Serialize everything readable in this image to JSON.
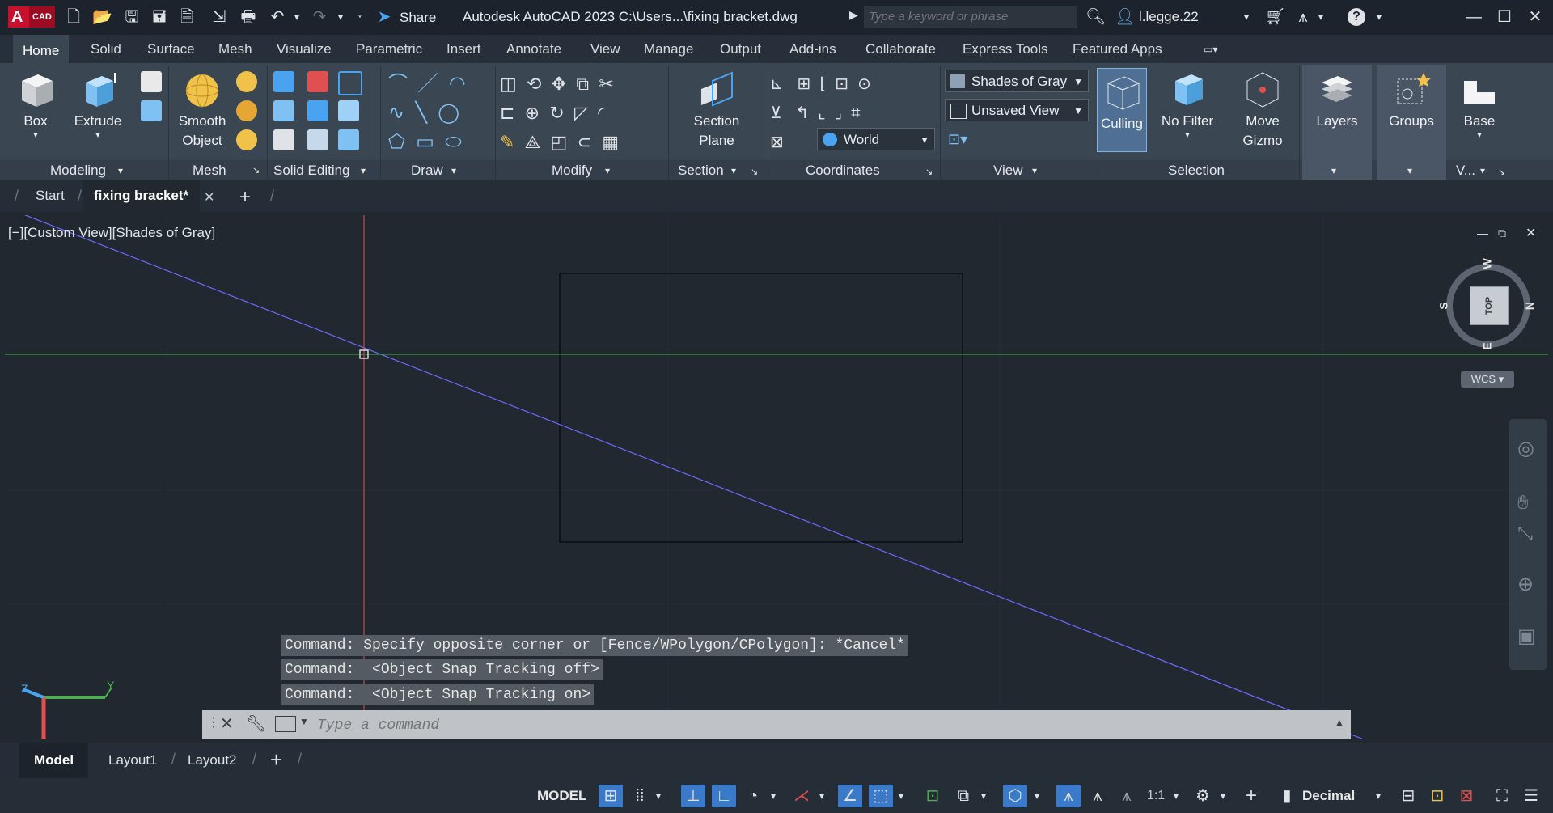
{
  "titlebar": {
    "app_logo_letter": "A",
    "app_logo_badge": "CAD",
    "share_label": "Share",
    "title": "Autodesk AutoCAD 2023    C:\\Users...\\fixing bracket.dwg",
    "search_placeholder": "Type a keyword or phrase",
    "user_name": "l.legge.22"
  },
  "ribbon_tabs": [
    "Home",
    "Solid",
    "Surface",
    "Mesh",
    "Visualize",
    "Parametric",
    "Insert",
    "Annotate",
    "View",
    "Manage",
    "Output",
    "Add-ins",
    "Collaborate",
    "Express Tools",
    "Featured Apps"
  ],
  "ribbon": {
    "modeling": {
      "box": "Box",
      "extrude": "Extrude",
      "label": "Modeling"
    },
    "mesh": {
      "smooth": "Smooth",
      "object": "Object",
      "label": "Mesh"
    },
    "solid_editing": {
      "label": "Solid Editing"
    },
    "draw": {
      "label": "Draw"
    },
    "modify": {
      "label": "Modify"
    },
    "section": {
      "section": "Section",
      "plane": "Plane",
      "label": "Section"
    },
    "coordinates": {
      "world": "World",
      "label": "Coordinates"
    },
    "view": {
      "visual_style": "Shades of Gray",
      "saved_view": "Unsaved View",
      "label": "View"
    },
    "selection": {
      "culling": "Culling",
      "no_filter": "No Filter",
      "move": "Move",
      "gizmo": "Gizmo",
      "label": "Selection"
    },
    "layers": {
      "label": "Layers"
    },
    "groups": {
      "label": "Groups"
    },
    "base": {
      "label": "Base",
      "panel_label": "V..."
    }
  },
  "doc_tabs": {
    "start": "Start",
    "active": "fixing bracket*"
  },
  "viewport": {
    "label": "[−][Custom View][Shades of Gray]",
    "viewcube": {
      "top": "TOP",
      "n": "N",
      "s": "S",
      "w": "W",
      "e": "E",
      "wcs": "WCS"
    },
    "ucs": {
      "y": "Y",
      "z": "Z"
    }
  },
  "command_history": [
    "Command: Specify opposite corner or [Fence/WPolygon/CPolygon]: *Cancel*",
    "Command:  <Object Snap Tracking off>",
    "Command:  <Object Snap Tracking on>"
  ],
  "command_input": {
    "placeholder": "Type a command"
  },
  "layout_tabs": [
    "Model",
    "Layout1",
    "Layout2"
  ],
  "statusbar": {
    "model": "MODEL",
    "scale": "1:1",
    "units": "Decimal"
  },
  "colors": {
    "accent": "#3b79c9",
    "x_axis": "#e05050",
    "y_axis": "#4caf50",
    "construction": "#6b6bff"
  }
}
